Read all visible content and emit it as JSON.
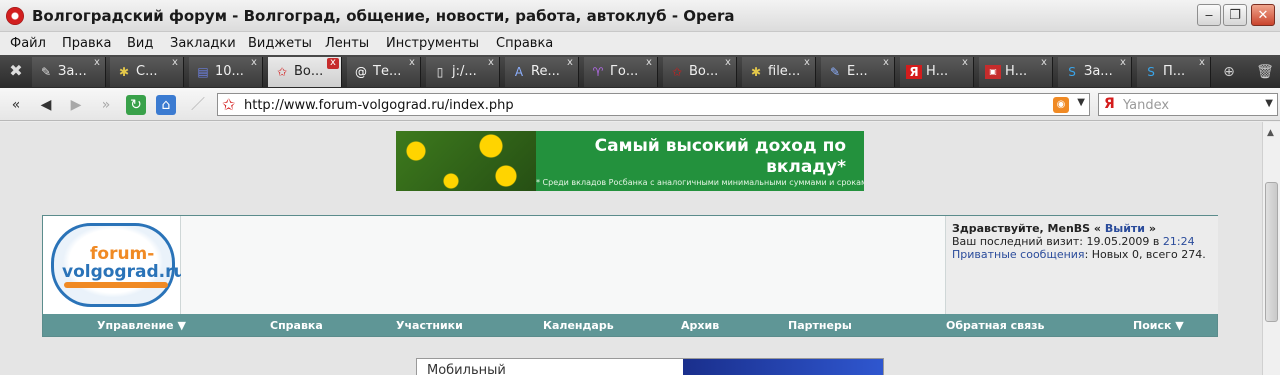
{
  "window": {
    "title": "Волгоградский форум - Волгоград, общение, новости, работа, автоклуб - Opera",
    "minimize_label": "‒",
    "maximize_label": "❐",
    "close_label": "✕"
  },
  "menu": [
    "Файл",
    "Правка",
    "Вид",
    "Закладки",
    "Виджеты",
    "Ленты",
    "Инструменты",
    "Справка"
  ],
  "tabs": [
    {
      "label": "За...",
      "icon": "pen-icon",
      "active": false
    },
    {
      "label": "С...",
      "icon": "bug-icon",
      "active": false
    },
    {
      "label": "10...",
      "icon": "book-icon",
      "active": false
    },
    {
      "label": "Во...",
      "icon": "star-icon",
      "active": true
    },
    {
      "label": "Те...",
      "icon": "at-icon",
      "active": false
    },
    {
      "label": "j:/...",
      "icon": "document-icon",
      "active": false
    },
    {
      "label": "Re...",
      "icon": "a-letter-icon",
      "active": false
    },
    {
      "label": "Го...",
      "icon": "aries-icon",
      "active": false
    },
    {
      "label": "Во...",
      "icon": "star-icon",
      "active": false
    },
    {
      "label": "file...",
      "icon": "bug-icon",
      "active": false
    },
    {
      "label": "E...",
      "icon": "pencil-icon",
      "active": false
    },
    {
      "label": "Н...",
      "icon": "yandex-icon",
      "active": false
    },
    {
      "label": "Н...",
      "icon": "news-icon",
      "active": false
    },
    {
      "label": "За...",
      "icon": "skype-icon",
      "active": false
    },
    {
      "label": "П...",
      "icon": "skype-icon",
      "active": false
    }
  ],
  "address": {
    "url": "http://www.forum-volgograd.ru/index.php",
    "search_placeholder": "Yandex",
    "search_engine_letter": "Я"
  },
  "banner": {
    "headline": "Самый высокий доход по вкладу*",
    "fine_print": "* Среди вкладов Росбанка с аналогичными минимальными суммами и сроками"
  },
  "logo": {
    "line1": "forum-",
    "line2": "volgograd.ru"
  },
  "user": {
    "greeting": "Здравствуйте, MenBS",
    "greeting_open": " « ",
    "logout": "Выйти",
    "greeting_close": " »",
    "last_visit_label": "Ваш последний визит: 19.05.2009 в ",
    "last_visit_time": "21:24",
    "pm_link": "Приватные сообщения",
    "pm_stats": ": Новых 0, всего 274."
  },
  "nav": [
    "Управление ▼",
    "Справка",
    "Участники",
    "Календарь",
    "Архив",
    "Партнеры",
    "Обратная связь",
    "Поиск ▼"
  ],
  "bottom_ad": {
    "text": "Мобильный"
  }
}
